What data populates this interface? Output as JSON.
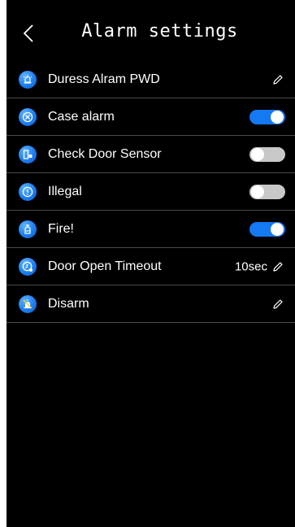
{
  "header": {
    "title": "Alarm settings",
    "back_icon": "chevron-left-icon"
  },
  "colors": {
    "background": "#000000",
    "accent": "#1479f2",
    "toggle_off": "#c8c8c8",
    "divider": "#4a4a4a"
  },
  "rows": [
    {
      "label": "Duress Alram PWD",
      "icon": "duress-alarm-icon",
      "control": "edit",
      "value": ""
    },
    {
      "label": "Case alarm",
      "icon": "case-alarm-icon",
      "control": "toggle",
      "on": true
    },
    {
      "label": "Check Door Sensor",
      "icon": "door-sensor-icon",
      "control": "toggle",
      "on": false
    },
    {
      "label": "Illegal",
      "icon": "illegal-alarm-icon",
      "control": "toggle",
      "on": false
    },
    {
      "label": "Fire!",
      "icon": "fire-alarm-icon",
      "control": "toggle",
      "on": true
    },
    {
      "label": "Door Open Timeout",
      "icon": "timeout-clock-icon",
      "control": "edit",
      "value": "10sec"
    },
    {
      "label": "Disarm",
      "icon": "disarm-icon",
      "control": "edit",
      "value": ""
    }
  ]
}
